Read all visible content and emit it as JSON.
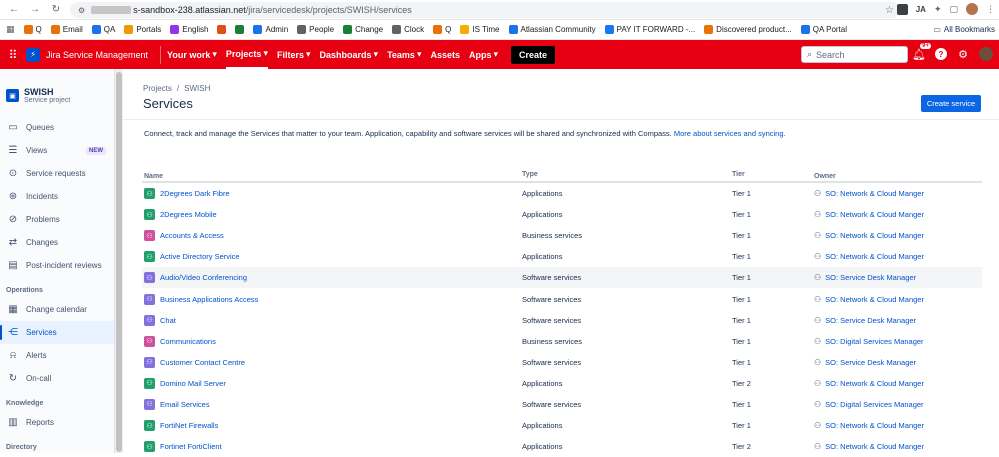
{
  "browser": {
    "url_host": "s-sandbox-238.atlassian.net",
    "url_path": "/jira/servicedesk/projects/SWISH/services",
    "bookmarks": [
      {
        "label": "Q",
        "color": "#e8710a"
      },
      {
        "label": "Email",
        "color": "#e8710a"
      },
      {
        "label": "QA",
        "color": "#1a73e8"
      },
      {
        "label": "Portals",
        "color": "#f29900"
      },
      {
        "label": "English",
        "color": "#9334e6"
      },
      {
        "label": "",
        "color": "#e04f1a"
      },
      {
        "label": "",
        "color": "#188038"
      },
      {
        "label": "Admin",
        "color": "#1a73e8"
      },
      {
        "label": "People",
        "color": "#5f6368"
      },
      {
        "label": "Change",
        "color": "#188038"
      },
      {
        "label": "Clock",
        "color": "#5f6368"
      },
      {
        "label": "Q",
        "color": "#e8710a"
      },
      {
        "label": "IS Time",
        "color": "#f9ab00"
      },
      {
        "label": "Atlassian Community",
        "color": "#1a73e8"
      },
      {
        "label": "PAY IT FORWARD -...",
        "color": "#1877f2"
      },
      {
        "label": "Discovered product...",
        "color": "#e8710a"
      },
      {
        "label": "QA Portal",
        "color": "#1a73e8"
      }
    ],
    "all_bookmarks": "All Bookmarks"
  },
  "topnav": {
    "product": "Jira Service Management",
    "items": [
      "Your work",
      "Projects",
      "Filters",
      "Dashboards",
      "Teams",
      "Assets",
      "Apps"
    ],
    "create": "Create",
    "search_placeholder": "Search",
    "notif_count": "9+"
  },
  "sidebar": {
    "project_name": "SWISH",
    "project_type": "Service project",
    "items": [
      {
        "label": "Queues",
        "icon": "queues-icon",
        "glyph": "▭"
      },
      {
        "label": "Views",
        "icon": "views-icon",
        "glyph": "☰",
        "badge": "NEW"
      },
      {
        "label": "Service requests",
        "icon": "service-requests-icon",
        "glyph": "⊙"
      },
      {
        "label": "Incidents",
        "icon": "incidents-icon",
        "glyph": "⊛"
      },
      {
        "label": "Problems",
        "icon": "problems-icon",
        "glyph": "⊘"
      },
      {
        "label": "Changes",
        "icon": "changes-icon",
        "glyph": "⇄"
      },
      {
        "label": "Post-incident reviews",
        "icon": "post-incident-icon",
        "glyph": "▤"
      }
    ],
    "operations_heading": "Operations",
    "operations": [
      {
        "label": "Change calendar",
        "icon": "calendar-icon",
        "glyph": "▦"
      },
      {
        "label": "Services",
        "icon": "services-icon",
        "glyph": "⋲"
      },
      {
        "label": "Alerts",
        "icon": "alerts-icon",
        "glyph": "⍾"
      },
      {
        "label": "On-call",
        "icon": "on-call-icon",
        "glyph": "↻"
      }
    ],
    "knowledge_heading": "Knowledge",
    "knowledge": [
      {
        "label": "Reports",
        "icon": "reports-icon",
        "glyph": "▥"
      }
    ],
    "directory_heading": "Directory"
  },
  "main": {
    "breadcrumb_projects": "Projects",
    "breadcrumb_sep": "/",
    "breadcrumb_project": "SWISH",
    "title": "Services",
    "create_button": "Create service",
    "description": "Connect, track and manage the Services that matter to your team. Application, capability and software services will be shared and synchronized with Compass.",
    "description_link": "More about services and syncing.",
    "columns": [
      "Name",
      "Type",
      "Tier",
      "Owner"
    ],
    "rows": [
      {
        "name": "2Degrees Dark Fibre",
        "type": "Applications",
        "tier": "Tier 1",
        "owner": "SO: Network & Cloud Manger",
        "color": "#22a06b"
      },
      {
        "name": "2Degrees Mobile",
        "type": "Applications",
        "tier": "Tier 1",
        "owner": "SO: Network & Cloud Manger",
        "color": "#22a06b"
      },
      {
        "name": "Accounts & Access",
        "type": "Business services",
        "tier": "Tier 1",
        "owner": "SO: Network & Cloud Manger",
        "color": "#cd519d"
      },
      {
        "name": "Active Directory Service",
        "type": "Applications",
        "tier": "Tier 1",
        "owner": "SO: Network & Cloud Manger",
        "color": "#22a06b"
      },
      {
        "name": "Audio/Video Conferencing",
        "type": "Software services",
        "tier": "Tier 1",
        "owner": "SO: Service Desk Manager",
        "color": "#8270db"
      },
      {
        "name": "Business Applications Access",
        "type": "Software services",
        "tier": "Tier 1",
        "owner": "SO: Network & Cloud Manger",
        "color": "#8270db"
      },
      {
        "name": "Chat",
        "type": "Software services",
        "tier": "Tier 1",
        "owner": "SO: Service Desk Manager",
        "color": "#8270db"
      },
      {
        "name": "Communications",
        "type": "Business services",
        "tier": "Tier 1",
        "owner": "SO: Digital Services Manager",
        "color": "#cd519d"
      },
      {
        "name": "Customer Contact Centre",
        "type": "Software services",
        "tier": "Tier 1",
        "owner": "SO: Service Desk Manager",
        "color": "#8270db"
      },
      {
        "name": "Domino Mail Server",
        "type": "Applications",
        "tier": "Tier 2",
        "owner": "SO: Network & Cloud Manger",
        "color": "#22a06b"
      },
      {
        "name": "Email Services",
        "type": "Software services",
        "tier": "Tier 1",
        "owner": "SO: Digital Services Manager",
        "color": "#8270db"
      },
      {
        "name": "FortiNet Firewalls",
        "type": "Applications",
        "tier": "Tier 1",
        "owner": "SO: Network & Cloud Manger",
        "color": "#22a06b"
      },
      {
        "name": "Fortinet FortiClient",
        "type": "Applications",
        "tier": "Tier 2",
        "owner": "SO: Network & Cloud Manger",
        "color": "#22a06b"
      }
    ]
  }
}
